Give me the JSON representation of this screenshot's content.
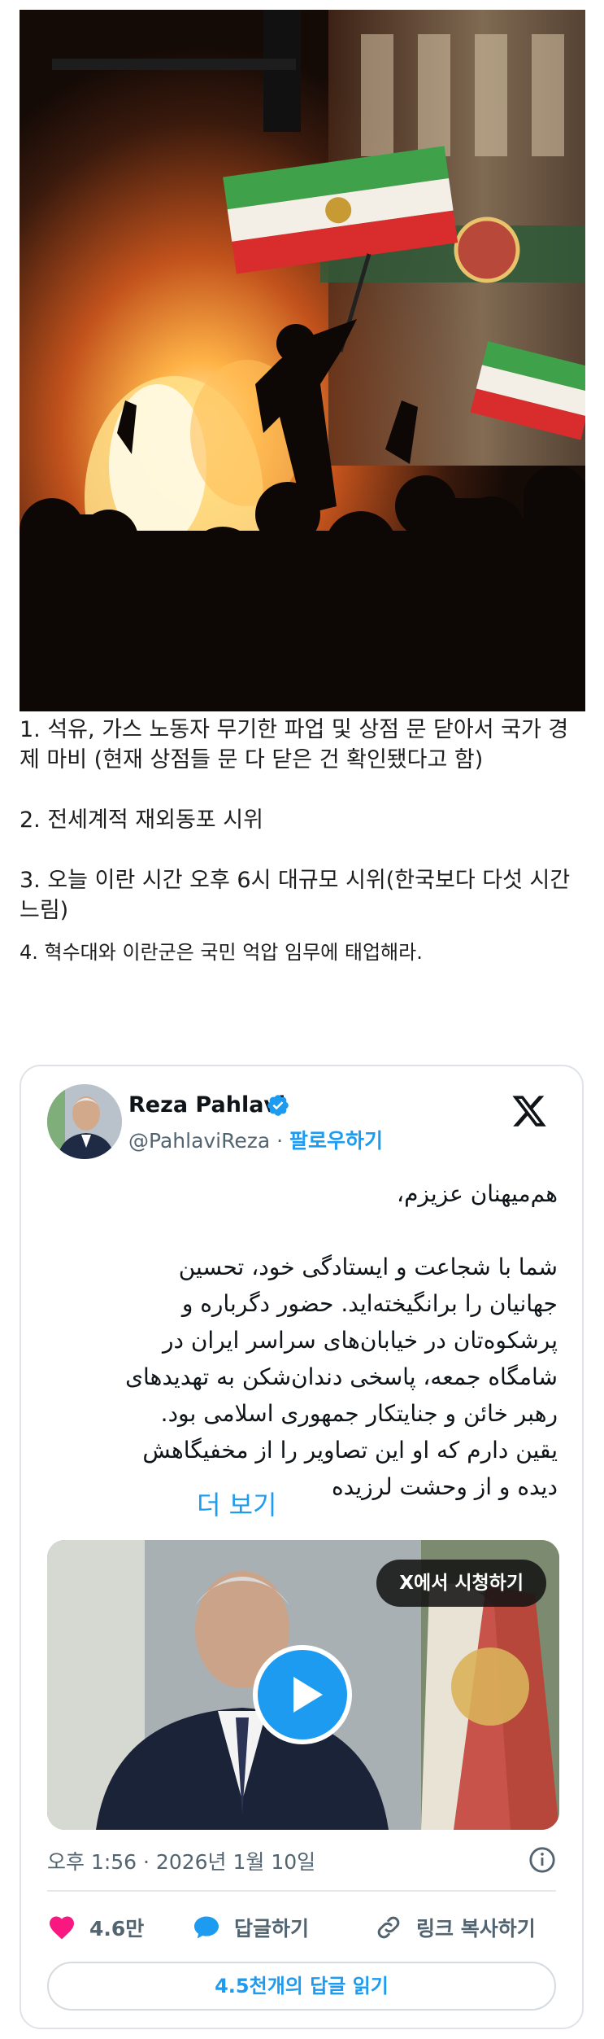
{
  "post": {
    "line1": "1. 석유, 가스 노동자 무기한 파업 및 상점 문 닫아서 국가 경제 마비 (현재 상점들 문 다 닫은 건 확인됐다고 함)",
    "line2": "2. 전세계적 재외동포 시위",
    "line3": "3. 오늘 이란 시간 오후 6시 대규모 시위(한국보다 다섯 시간 느림)",
    "line4": "4. 혁수대와 이란군은 국민 억압 임무에 태업해라."
  },
  "tweet": {
    "author_name": "Reza Pahlavi",
    "handle": "@PahlaviReza",
    "separator": " · ",
    "follow_label": "팔로우하기",
    "text_lines": [
      "هم‌میهنان عزیزم،",
      "",
      "شما با شجاعت و ایستادگی خود، تحسین",
      "جهانیان را برانگیخته‌اید. حضور دگرباره و",
      "پرشکوه‌تان در خیابان‌های سراسر ایران در",
      "شامگاه جمعه، پاسخی دندان‌شکن به تهدیدهای",
      "رهبر خائن و جنایتکار جمهوری اسلامی بود.",
      "یقین دارم که او این تصاویر را از مخفیگاهش",
      "دیده و از وحشت لرزیده"
    ],
    "more_label": "더 보기",
    "watch_on_x_label": "X에서 시청하기",
    "timestamp": "오후 1:56 · 2026년 1월 10일",
    "likes": "4.6만",
    "reply_label": "답글하기",
    "copy_link_label": "링크 복사하기",
    "read_replies_label": "4.5천개의 답글 읽기"
  },
  "colors": {
    "accent": "#1d9bf0",
    "like": "#f91880",
    "muted": "#536471"
  }
}
